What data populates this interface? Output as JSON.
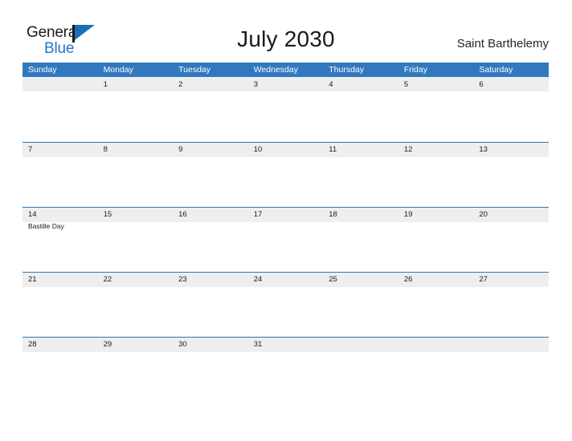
{
  "brand": {
    "name_part1": "General",
    "name_part2": "Blue",
    "flag_icon": "flag-icon"
  },
  "header": {
    "title": "July 2030",
    "location": "Saint Barthelemy"
  },
  "colors": {
    "header_blue": "#3178be",
    "row_band_gray": "#eeeeee",
    "row_border_blue": "#2e75b6",
    "brand_blue": "#2176c7",
    "text_dark": "#1a1a1a"
  },
  "calendar": {
    "weekdays": [
      "Sunday",
      "Monday",
      "Tuesday",
      "Wednesday",
      "Thursday",
      "Friday",
      "Saturday"
    ],
    "weeks": [
      [
        {
          "day": ""
        },
        {
          "day": "1"
        },
        {
          "day": "2"
        },
        {
          "day": "3"
        },
        {
          "day": "4"
        },
        {
          "day": "5"
        },
        {
          "day": "6"
        }
      ],
      [
        {
          "day": "7"
        },
        {
          "day": "8"
        },
        {
          "day": "9"
        },
        {
          "day": "10"
        },
        {
          "day": "11"
        },
        {
          "day": "12"
        },
        {
          "day": "13"
        }
      ],
      [
        {
          "day": "14",
          "event": "Bastille Day"
        },
        {
          "day": "15"
        },
        {
          "day": "16"
        },
        {
          "day": "17"
        },
        {
          "day": "18"
        },
        {
          "day": "19"
        },
        {
          "day": "20"
        }
      ],
      [
        {
          "day": "21"
        },
        {
          "day": "22"
        },
        {
          "day": "23"
        },
        {
          "day": "24"
        },
        {
          "day": "25"
        },
        {
          "day": "26"
        },
        {
          "day": "27"
        }
      ],
      [
        {
          "day": "28"
        },
        {
          "day": "29"
        },
        {
          "day": "30"
        },
        {
          "day": "31"
        },
        {
          "day": ""
        },
        {
          "day": ""
        },
        {
          "day": ""
        }
      ]
    ]
  }
}
